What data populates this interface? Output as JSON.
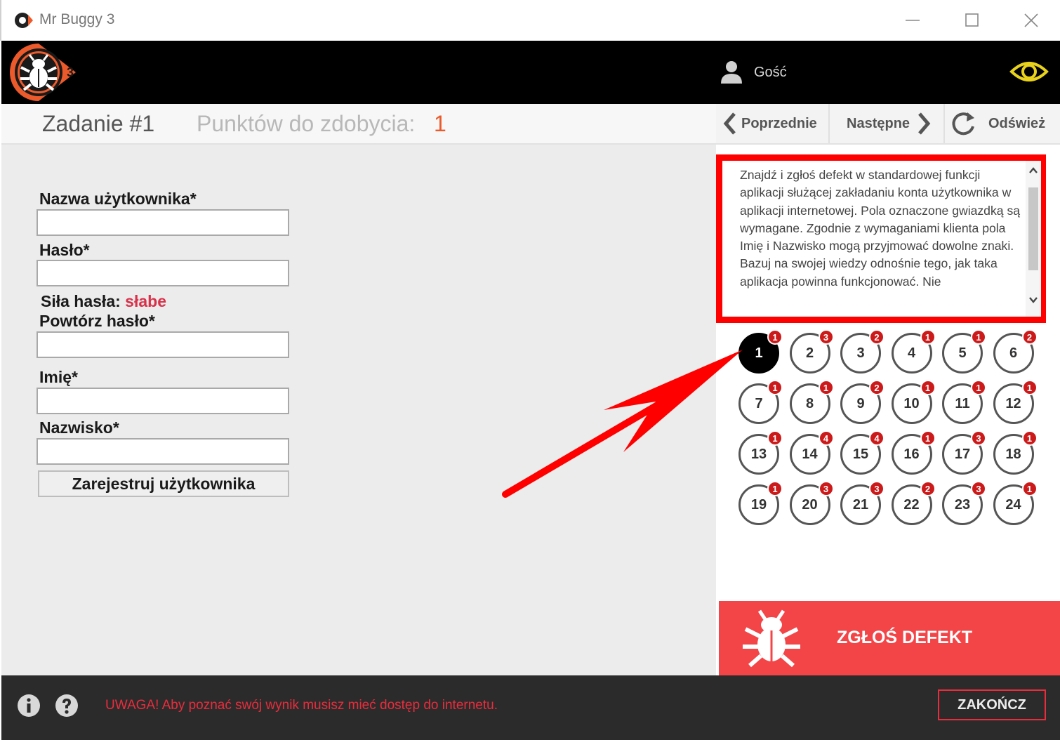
{
  "window": {
    "title": "Mr Buggy 3"
  },
  "header": {
    "user": "Gość"
  },
  "task": {
    "title": "Zadanie #1",
    "points_label": "Punktów do zdobycia:",
    "points_value": "1"
  },
  "nav": {
    "prev": "Poprzednie",
    "next": "Następne",
    "refresh": "Odśwież"
  },
  "form": {
    "username_label": "Nazwa użytkownika*",
    "username_value": "",
    "password_label": "Hasło*",
    "password_value": "",
    "strength_label": "Siła hasła:",
    "strength_value": "słabe",
    "repeat_label": "Powtórz hasło*",
    "repeat_value": "",
    "firstname_label": "Imię*",
    "firstname_value": "",
    "lastname_label": "Nazwisko*",
    "lastname_value": "",
    "submit_label": "Zarejestruj użytkownika"
  },
  "description": "Znajdź i zgłoś defekt w standardowej funkcji aplikacji służącej zakładaniu konta użytkownika w aplikacji internetowej. Pola oznaczone gwiazdką są wymagane. Zgodnie z wymaganiami klienta pola Imię i Nazwisko mogą przyjmować dowolne znaki. Bazuj na swojej wiedzy odnośnie tego, jak taka aplikacja powinna funkcjonować. Nie",
  "tasks": [
    {
      "n": "1",
      "badge": "1",
      "active": true
    },
    {
      "n": "2",
      "badge": "3"
    },
    {
      "n": "3",
      "badge": "2"
    },
    {
      "n": "4",
      "badge": "1"
    },
    {
      "n": "5",
      "badge": "1"
    },
    {
      "n": "6",
      "badge": "2"
    },
    {
      "n": "7",
      "badge": "1"
    },
    {
      "n": "8",
      "badge": "1"
    },
    {
      "n": "9",
      "badge": "2"
    },
    {
      "n": "10",
      "badge": "1"
    },
    {
      "n": "11",
      "badge": "1"
    },
    {
      "n": "12",
      "badge": "1"
    },
    {
      "n": "13",
      "badge": "1"
    },
    {
      "n": "14",
      "badge": "4"
    },
    {
      "n": "15",
      "badge": "4"
    },
    {
      "n": "16",
      "badge": "1"
    },
    {
      "n": "17",
      "badge": "3"
    },
    {
      "n": "18",
      "badge": "1"
    },
    {
      "n": "19",
      "badge": "1"
    },
    {
      "n": "20",
      "badge": "3"
    },
    {
      "n": "21",
      "badge": "3"
    },
    {
      "n": "22",
      "badge": "2"
    },
    {
      "n": "23",
      "badge": "3"
    },
    {
      "n": "24",
      "badge": "1"
    }
  ],
  "report": {
    "label": "ZGŁOŚ DEFEKT"
  },
  "footer": {
    "warning": "UWAGA! Aby poznać swój wynik musisz mieć dostęp do internetu.",
    "finish": "ZAKOŃCZ"
  },
  "colors": {
    "accent_orange": "#ec5a2b",
    "report_red": "#f34548",
    "highlight_red": "#ff0000",
    "eye_yellow": "#e8d21c"
  },
  "icons": [
    "app-icon",
    "bug-logo-icon",
    "user-icon",
    "eye-icon",
    "chevron-left-icon",
    "chevron-right-icon",
    "refresh-icon",
    "info-icon",
    "help-icon",
    "bug-icon"
  ]
}
